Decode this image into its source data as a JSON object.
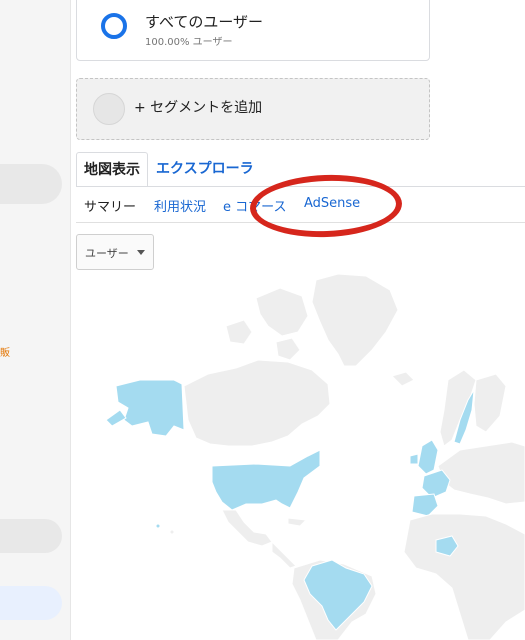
{
  "sidebar": {
    "orange_fragment": "販"
  },
  "segment": {
    "title": "すべてのユーザー",
    "subtitle": "100.00% ユーザー"
  },
  "add_segment": {
    "label": "+ セグメントを追加"
  },
  "view_tabs": [
    {
      "label": "地図表示",
      "active": true
    },
    {
      "label": "エクスプローラ",
      "active": false
    }
  ],
  "subtabs": [
    {
      "label": "サマリー",
      "active": true
    },
    {
      "label": "利用状況",
      "active": false
    },
    {
      "label": "e コマース",
      "active": false
    },
    {
      "label": "AdSense",
      "active": false
    }
  ],
  "metric_dropdown": {
    "value": "ユーザー"
  },
  "map": {
    "highlight_color": "#a4dbf0",
    "base_color": "#eeeeee",
    "highlighted_countries": [
      "アラスカ",
      "アメリカ",
      "ブラジル",
      "イギリス",
      "フランス",
      "スペイン",
      "スウェーデン",
      "コンゴ"
    ]
  },
  "colors": {
    "accent": "#1967d2",
    "annotation": "#d6261c"
  }
}
